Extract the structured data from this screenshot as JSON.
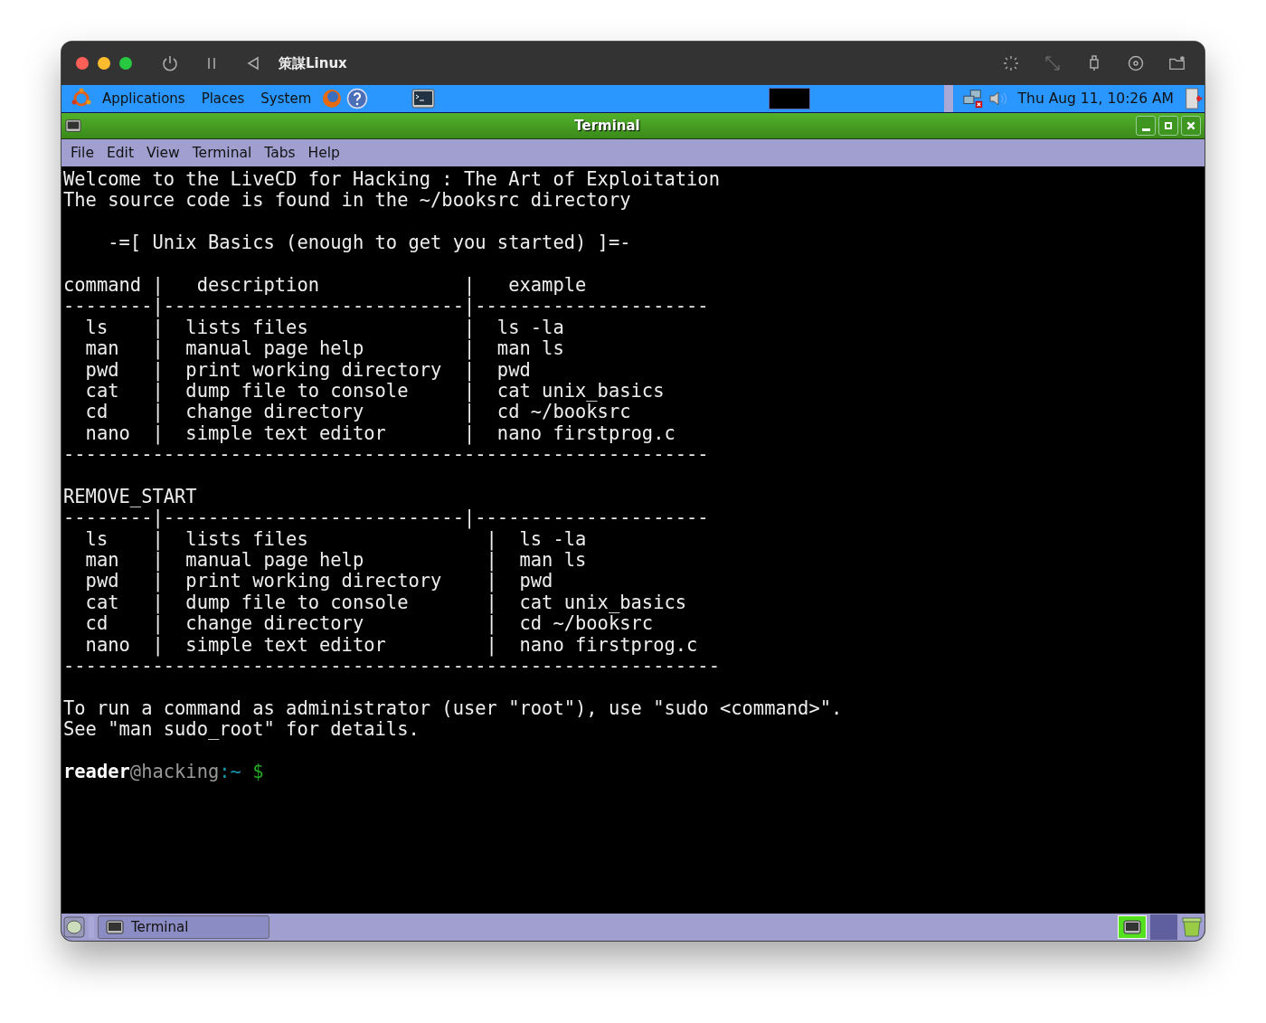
{
  "host_window": {
    "title": "策謀Linux"
  },
  "panel": {
    "menus": [
      "Applications",
      "Places",
      "System"
    ],
    "clock": "Thu Aug 11, 10:26 AM"
  },
  "terminal_window": {
    "title": "Terminal",
    "menu": [
      "File",
      "Edit",
      "View",
      "Terminal",
      "Tabs",
      "Help"
    ]
  },
  "terminal": {
    "blocks": [
      [
        "Welcome to the LiveCD for Hacking : The Art of Exploitation",
        "The source code is found in the ~/booksrc directory"
      ],
      [
        "    -=[ Unix Basics (enough to get you started) ]=-"
      ],
      [
        "command |   description             |   example",
        "--------|---------------------------|---------------------",
        "  ls    |  lists files              |  ls -la",
        "  man   |  manual page help         |  man ls",
        "  pwd   |  print working directory  |  pwd",
        "  cat   |  dump file to console     |  cat unix_basics",
        "  cd    |  change directory         |  cd ~/booksrc",
        "  nano  |  simple text editor       |  nano firstprog.c",
        "----------------------------------------------------------"
      ],
      [
        "REMOVE_START",
        "--------|---------------------------|---------------------",
        "  ls    |  lists files                |  ls -la",
        "  man   |  manual page help           |  man ls",
        "  pwd   |  print working directory    |  pwd",
        "  cat   |  dump file to console       |  cat unix_basics",
        "  cd    |  change directory           |  cd ~/booksrc",
        "  nano  |  simple text editor         |  nano firstprog.c",
        "-----------------------------------------------------------"
      ],
      [
        "To run a command as administrator (user \"root\"), use \"sudo <command>\".",
        "See \"man sudo_root\" for details."
      ]
    ],
    "prompt": {
      "user": "reader",
      "host": "@hacking",
      "path": ":~",
      "symbol": "$"
    }
  },
  "taskbar": {
    "tasks": [
      {
        "label": "Terminal",
        "selected": true
      }
    ]
  }
}
